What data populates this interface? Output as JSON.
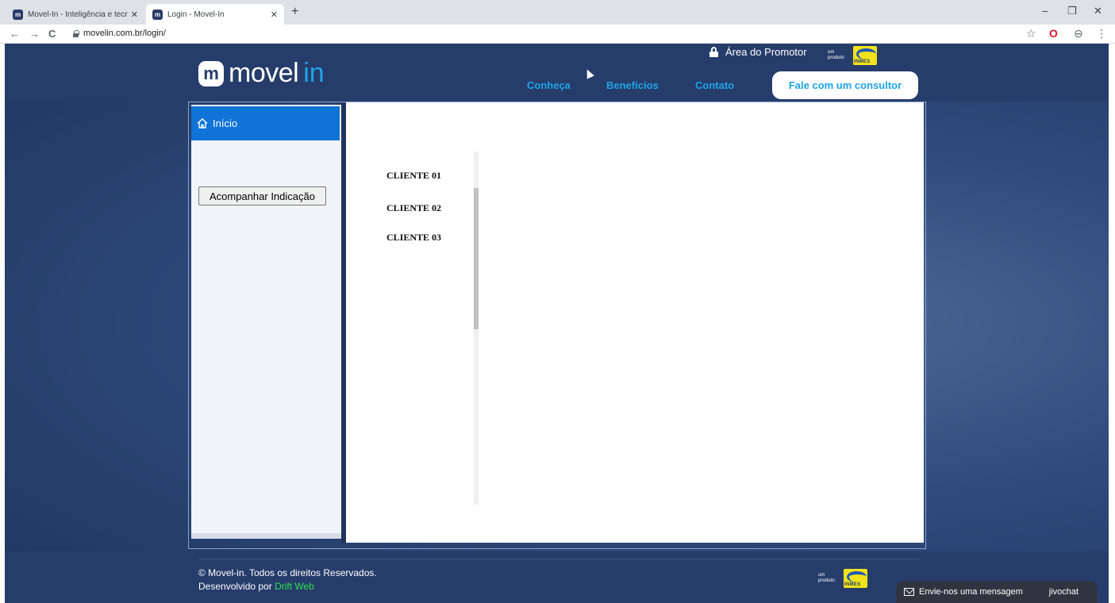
{
  "browser": {
    "tabs": [
      {
        "title": "Movel-In - Inteligência e tecnolo",
        "favicon": "m"
      },
      {
        "title": "Login - Movel-In",
        "favicon": "m"
      }
    ],
    "new_tab": "+",
    "window": {
      "minimize": "–",
      "restore": "❐",
      "close": "✕"
    },
    "nav": {
      "back": "←",
      "forward": "→",
      "reload": "C"
    },
    "url": "movelin.com.br/login/",
    "toolbar": {
      "star": "☆",
      "opera": "O",
      "account": "⊖",
      "menu": "⋮"
    }
  },
  "header": {
    "logo_mark": "m",
    "logo_word": "movel",
    "logo_accent": "in",
    "promotor_label": "Área do Promotor",
    "produto_label": "um produto:",
    "inmes_text": "INMES",
    "nav": [
      "Conheça",
      "Benefícios",
      "Contato"
    ],
    "cta": "Fale com um consultor"
  },
  "sidebar": {
    "home_label": "Início",
    "button_label": "Acompanhar Indicação"
  },
  "content": {
    "clients": [
      "CLIENTE 01",
      "CLIENTE 02",
      "CLIENTE 03"
    ]
  },
  "footer": {
    "copyright": "© Movel-in. Todos os direitos Reservados.",
    "developed_by": "Desenvolvido por",
    "developer": "Drift Web",
    "produto_label": "um produto:",
    "inmes_text": "INMES"
  },
  "chat": {
    "label": "Envie-nos uma mensagem",
    "brand": "jivochat"
  },
  "colors": {
    "header_bg": "#263d6b",
    "accent": "#1fa3e6",
    "sidebar_active": "#0f73d7",
    "developer_link": "#2ee04c"
  }
}
